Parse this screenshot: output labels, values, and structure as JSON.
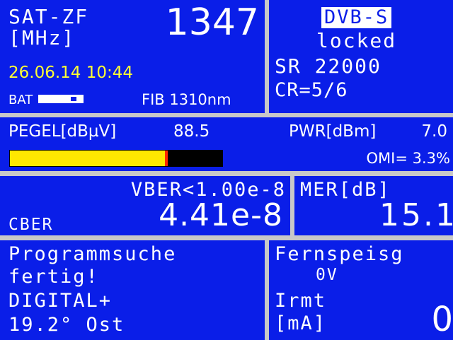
{
  "sat_zf": {
    "label": "SAT-ZF",
    "unit": "[MHz]",
    "value": "1347",
    "datetime": "26.06.14 10:44",
    "bat_label": "BAT",
    "battery_level": 0.72,
    "fib_label": "FIB 1310nm"
  },
  "signal": {
    "standard": "DVB-S",
    "status": "locked",
    "sr": "SR 22000",
    "cr": "CR=5/6"
  },
  "level": {
    "pegel_label": "PEGEL[dBµV]",
    "pegel_value": "88.5",
    "pwr_label": "PWR[dBm]",
    "pwr_value": "7.0",
    "omi": "OMI= 3.3%",
    "bar_fill": 0.73,
    "colors": {
      "fill": "#ffe800",
      "marker": "#ff2a00",
      "empty": "#000000"
    }
  },
  "ber": {
    "vber": "VBER<1.00e-8",
    "cber_label": "CBER",
    "cber_value": "4.41e-8"
  },
  "mer": {
    "label": "MER[dB]",
    "value": "15.1"
  },
  "scan": {
    "line1": "Programmsuche",
    "line2": "fertig!",
    "line3": "DIGITAL+",
    "line4": "19.2° Ost"
  },
  "lnb_power": {
    "label": "Fernspeisg",
    "voltage": "0V",
    "current_label": "Irmt",
    "current_unit": "[mA]",
    "current_value": "0"
  },
  "colors": {
    "panel_bg": "#0a1ee8",
    "frame": "#c8c8c8",
    "text": "#ffffff",
    "highlight": "#ffff33"
  }
}
